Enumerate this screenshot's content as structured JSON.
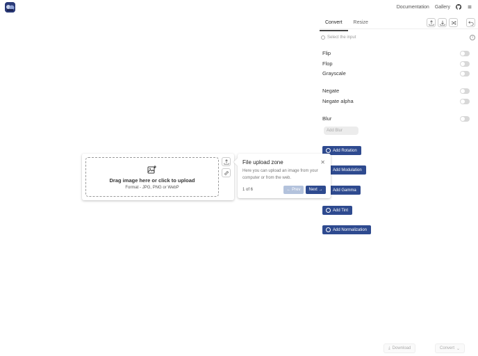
{
  "topnav": {
    "documentation": "Documentation",
    "gallery": "Gallery"
  },
  "tabs": [
    {
      "label": "Convert"
    },
    {
      "label": "Resize"
    }
  ],
  "select_hint": "Select the input",
  "options": {
    "flip": "Flip",
    "flop": "Flop",
    "grayscale": "Grayscale",
    "negate": "Negate",
    "negate_alpha": "Negate alpha",
    "blur": "Blur",
    "add_blur": "Add Blur",
    "add_rotation": "Add Rotation",
    "add_modulation": "Add Modulation",
    "add_gamma": "Add Gamma",
    "add_tint": "Add Tint",
    "add_normalization": "Add Normalization"
  },
  "footer": {
    "download": "Download",
    "convert": "Convert"
  },
  "upload": {
    "title": "Drag image here or click to upload",
    "subtitle": "Format - JPG, PNG or WebP"
  },
  "tour": {
    "title": "File upload zone",
    "description": "Here you can upload an image from your computer or from the web.",
    "counter": "1 of 6",
    "prev": "← Prev",
    "next": "Next →",
    "close": "✕"
  },
  "colors": {
    "accent": "#2e4a8f",
    "accent_disabled": "#b3c2dc"
  }
}
